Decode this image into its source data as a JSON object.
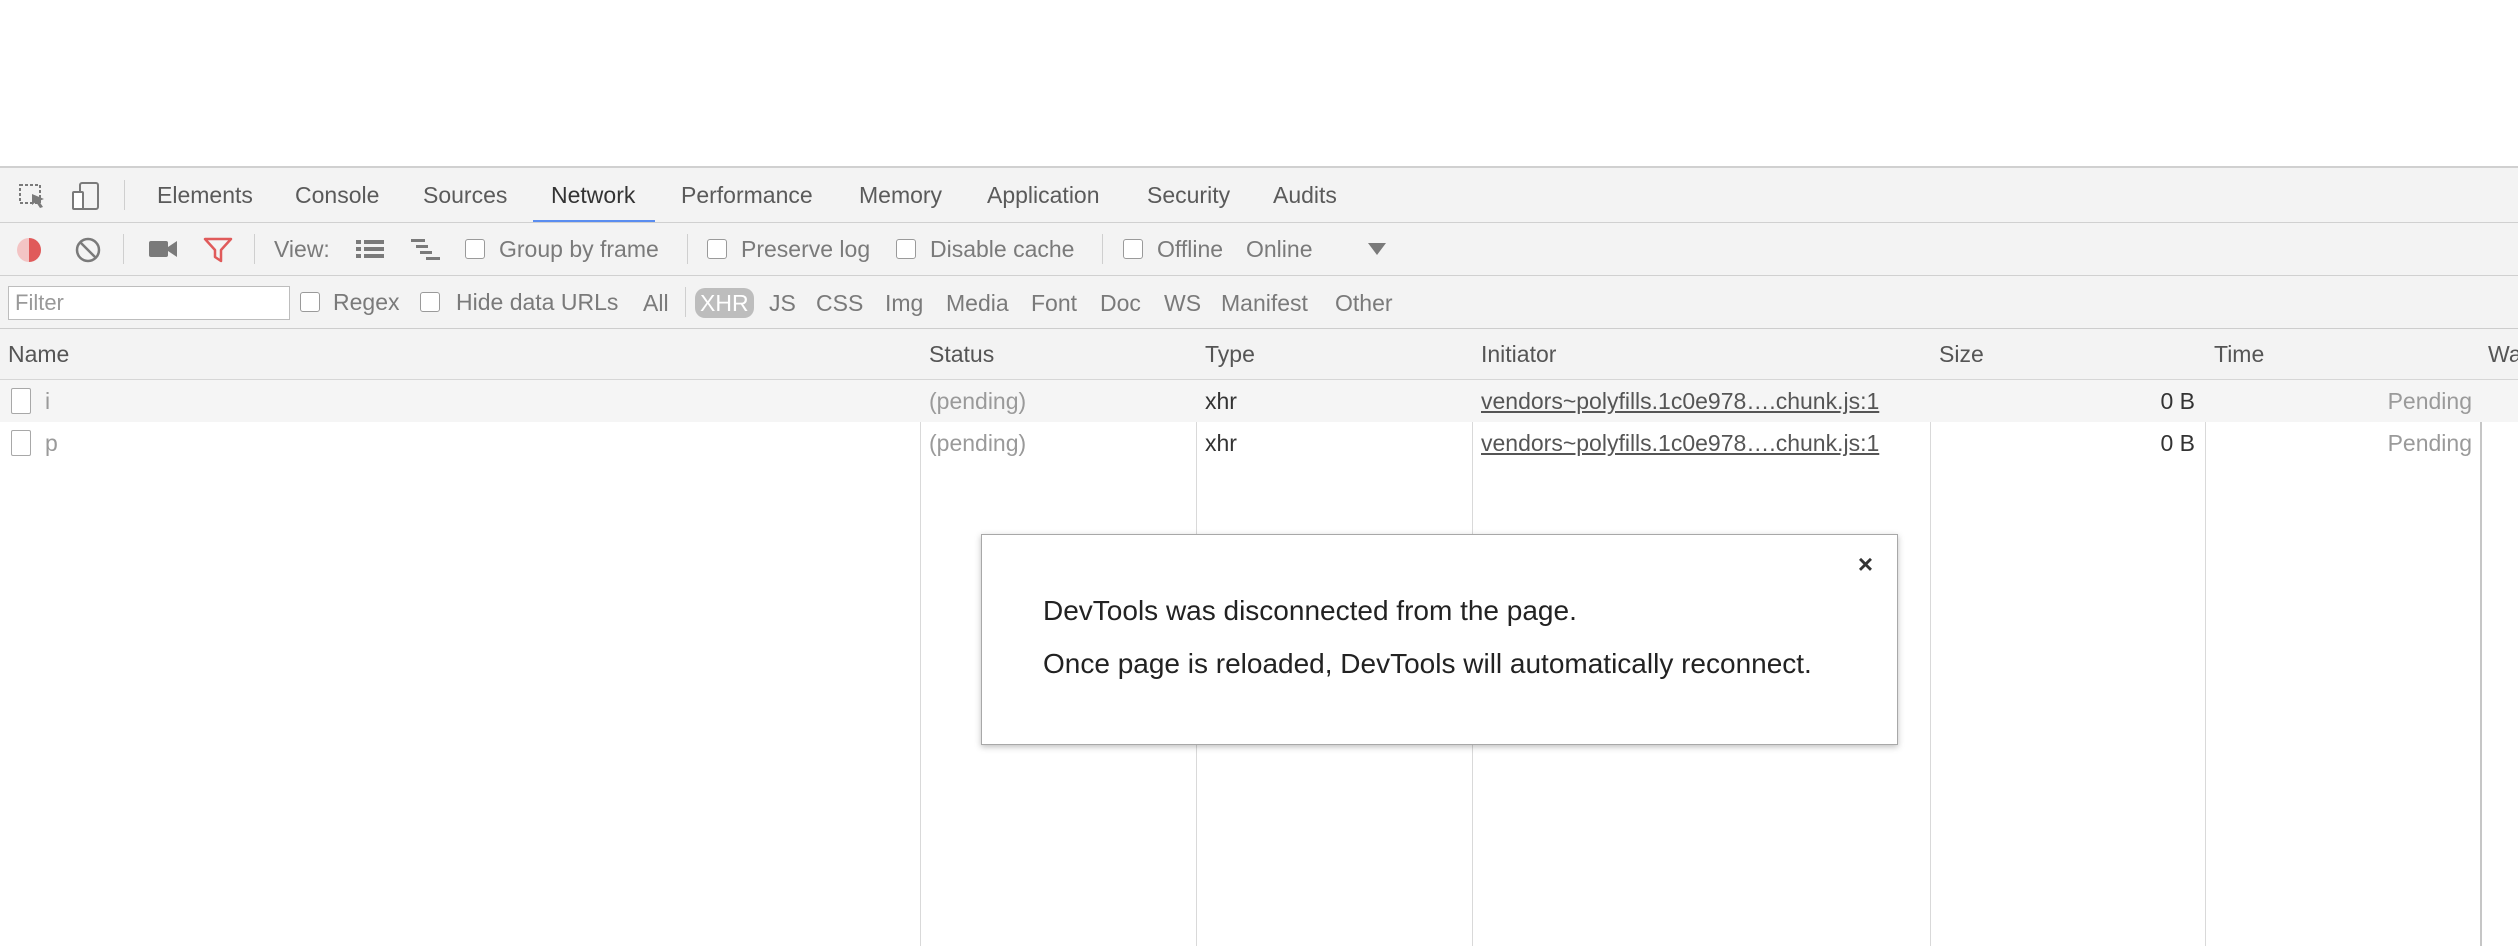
{
  "devtools": {
    "tabs": [
      "Elements",
      "Console",
      "Sources",
      "Network",
      "Performance",
      "Memory",
      "Application",
      "Security",
      "Audits"
    ],
    "active_tab": "Network",
    "toolbar": {
      "view_label": "View:",
      "group_by_frame": "Group by frame",
      "preserve_log": "Preserve log",
      "disable_cache": "Disable cache",
      "offline": "Offline",
      "throttling": "Online"
    },
    "filterbar": {
      "filter_placeholder": "Filter",
      "regex": "Regex",
      "hide_data_urls": "Hide data URLs",
      "types": [
        "All",
        "XHR",
        "JS",
        "CSS",
        "Img",
        "Media",
        "Font",
        "Doc",
        "WS",
        "Manifest",
        "Other"
      ],
      "selected_type": "XHR"
    },
    "table": {
      "columns": [
        "Name",
        "Status",
        "Type",
        "Initiator",
        "Size",
        "Time",
        "Wa"
      ],
      "rows": [
        {
          "name": "i",
          "status": "(pending)",
          "type": "xhr",
          "initiator": "vendors~polyfills.1c0e978….chunk.js:1",
          "size": "0 B",
          "time": "Pending"
        },
        {
          "name": "p",
          "status": "(pending)",
          "type": "xhr",
          "initiator": "vendors~polyfills.1c0e978….chunk.js:1",
          "size": "0 B",
          "time": "Pending"
        }
      ]
    },
    "dialog": {
      "close": "×",
      "line1": "DevTools was disconnected from the page.",
      "line2": "Once page is reloaded, DevTools will automatically reconnect."
    }
  },
  "colors": {
    "accent": "#5a8df0",
    "record": "#e05a5a",
    "filter_icon": "#e05a5a",
    "panel_bg": "#f3f3f3"
  },
  "icons": [
    "inspect-element-icon",
    "device-toolbar-icon",
    "record-icon",
    "clear-icon",
    "screenshot-camera-icon",
    "filter-icon",
    "large-rows-view-icon",
    "waterfall-view-icon",
    "dropdown-arrow-icon",
    "file-icon",
    "close-icon"
  ]
}
